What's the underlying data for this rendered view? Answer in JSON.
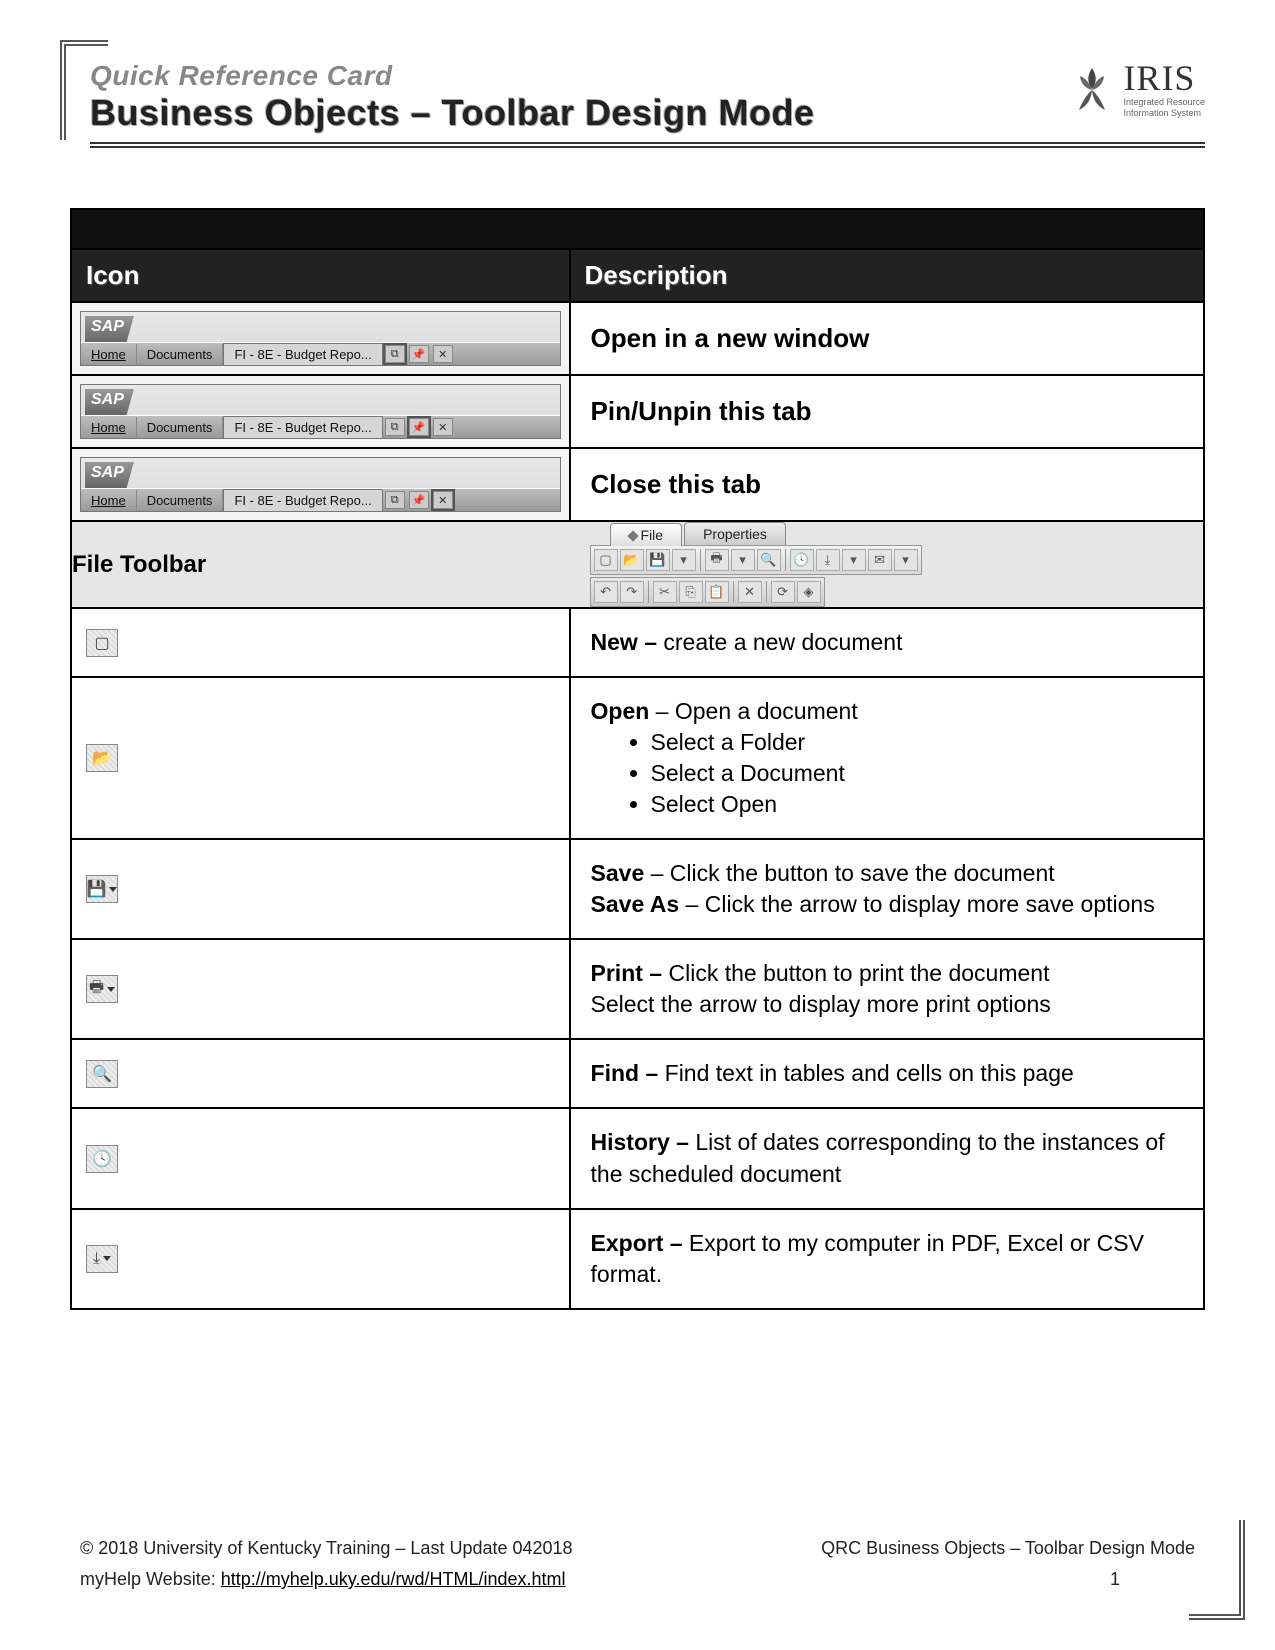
{
  "header": {
    "subtitle": "Quick Reference Card",
    "title": "Business Objects – Toolbar Design Mode",
    "logo_text": "IRIS",
    "logo_tag1": "Integrated Resource",
    "logo_tag2": "Information System"
  },
  "table": {
    "col_icon": "Icon",
    "col_desc": "Description",
    "sap_tabs": {
      "home": "Home",
      "documents": "Documents",
      "active": "FI - 8E - Budget Repo..."
    },
    "rows": [
      {
        "desc": "Open in a new window"
      },
      {
        "desc": "Pin/Unpin this tab"
      },
      {
        "desc": "Close this tab"
      }
    ],
    "file_toolbar": {
      "label": "File Toolbar",
      "tab_file": "File",
      "tab_properties": "Properties"
    },
    "file_rows": {
      "new": {
        "b": "New –",
        "t": " create a new document"
      },
      "open": {
        "b": "Open",
        "t": " – Open a document",
        "items": [
          "Select a Folder",
          "Select a Document",
          "Select Open"
        ]
      },
      "save": {
        "l1b": "Save",
        "l1t": " – Click the button to save the document",
        "l2b": "Save As",
        "l2t": " – Click the arrow to display more save options"
      },
      "print": {
        "l1b": "Print –",
        "l1t": " Click the button to print the document",
        "l2": "Select the arrow to display more print options"
      },
      "find": {
        "b": "Find –",
        "t": " Find text in tables and cells on this page"
      },
      "history": {
        "b": "History –",
        "t": " List of dates corresponding to the instances of the scheduled document"
      },
      "export": {
        "b": "Export –",
        "t": " Export to my computer in PDF, Excel or CSV format."
      }
    }
  },
  "footer": {
    "copyright": "© 2018 University of Kentucky Training – Last Update 042018",
    "doc_title": "QRC Business Objects – Toolbar Design Mode",
    "help_label": "myHelp Website:  ",
    "help_url": "http://myhelp.uky.edu/rwd/HTML/index.html",
    "page": "1"
  }
}
